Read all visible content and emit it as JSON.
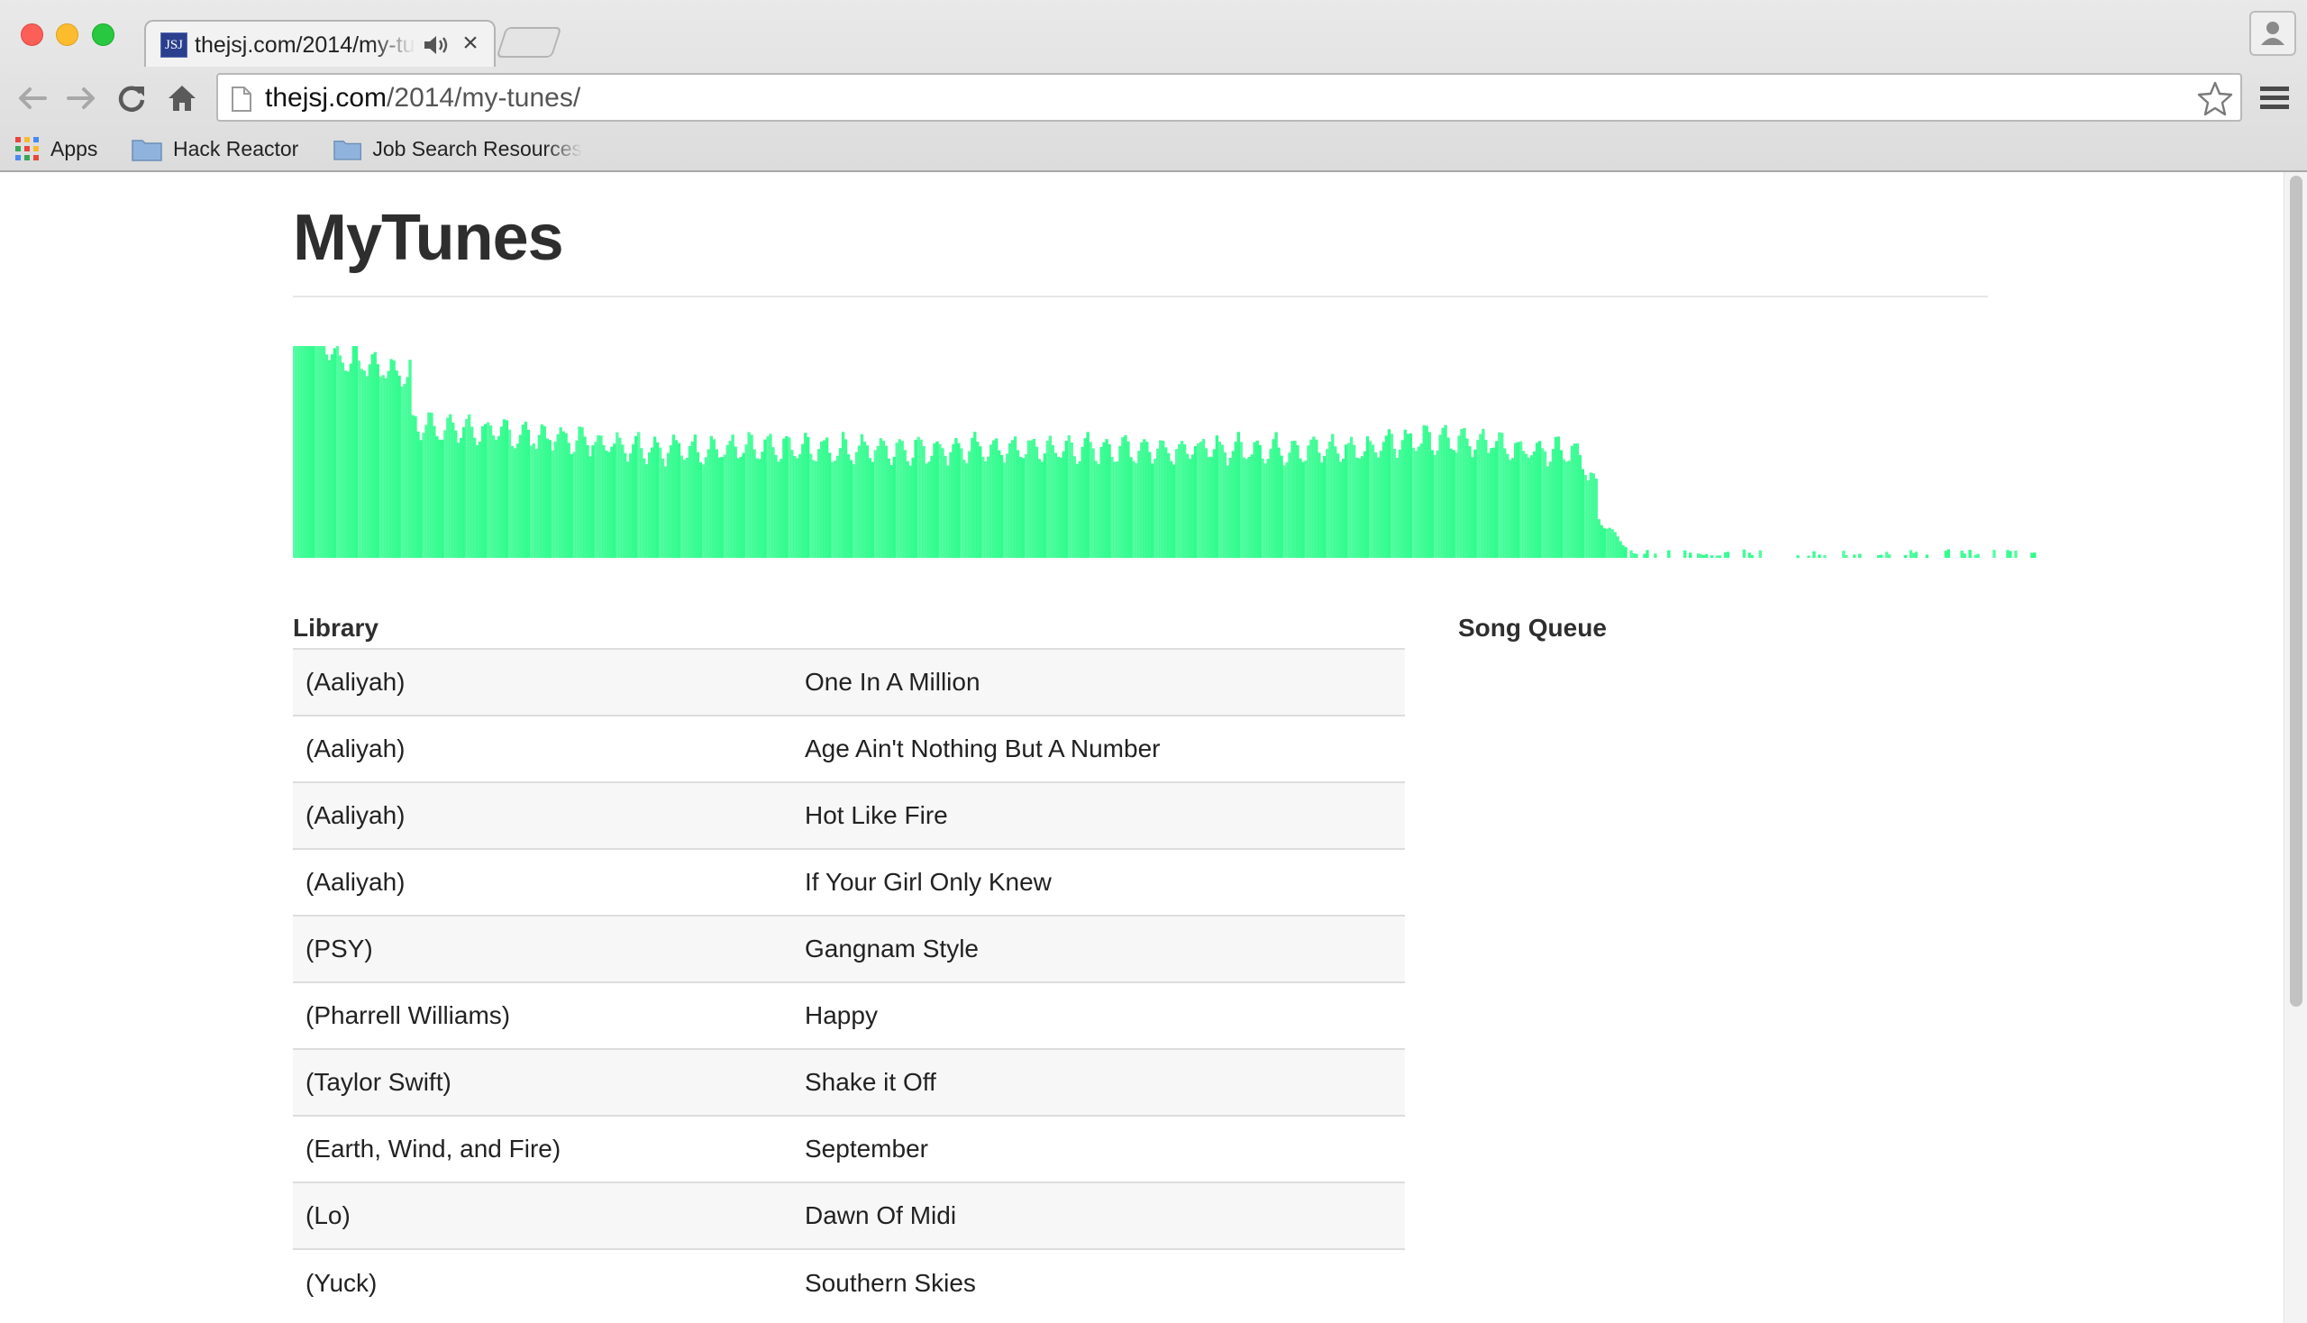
{
  "browser": {
    "tab": {
      "favicon_text": "JSJ",
      "title": "thejsj.com/2014/my-tunes/"
    },
    "address_bar": {
      "host": "thejsj.com",
      "path": "/2014/my-tunes/"
    },
    "bookmarks": [
      {
        "label": "Apps",
        "icon": "apps-grid-icon"
      },
      {
        "label": "Hack Reactor",
        "icon": "folder-icon"
      },
      {
        "label": "Job Search Resources",
        "icon": "folder-icon"
      }
    ]
  },
  "page": {
    "title": "MyTunes",
    "visualizer": {
      "color": "#2dfc8c"
    },
    "library": {
      "heading": "Library",
      "songs": [
        {
          "artist": "(Aaliyah)",
          "title": "One In A Million"
        },
        {
          "artist": "(Aaliyah)",
          "title": "Age Ain't Nothing But A Number"
        },
        {
          "artist": "(Aaliyah)",
          "title": "Hot Like Fire"
        },
        {
          "artist": "(Aaliyah)",
          "title": "If Your Girl Only Knew"
        },
        {
          "artist": "(PSY)",
          "title": "Gangnam Style"
        },
        {
          "artist": "(Pharrell Williams)",
          "title": "Happy"
        },
        {
          "artist": "(Taylor Swift)",
          "title": "Shake it Off"
        },
        {
          "artist": "(Earth, Wind, and Fire)",
          "title": "September"
        },
        {
          "artist": "(Lo)",
          "title": "Dawn Of Midi"
        },
        {
          "artist": "(Yuck)",
          "title": "Southern Skies"
        }
      ]
    },
    "queue": {
      "heading": "Song Queue"
    }
  }
}
